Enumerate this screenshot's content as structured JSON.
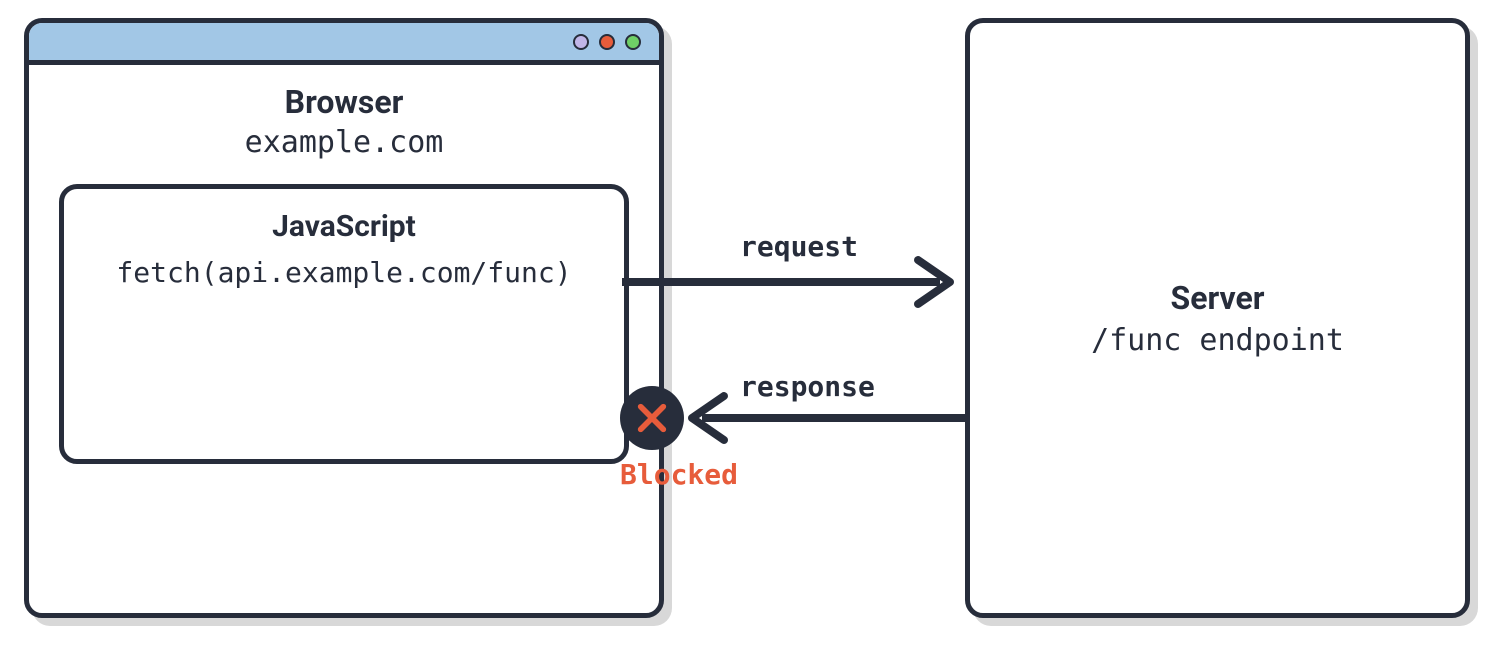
{
  "browser": {
    "heading": "Browser",
    "domain": "example.com",
    "traffic_lights": [
      "purple",
      "red",
      "green"
    ],
    "js": {
      "heading": "JavaScript",
      "code": "fetch(api.example.com/func)"
    }
  },
  "server": {
    "heading": "Server",
    "endpoint": "/func endpoint"
  },
  "arrows": {
    "request_label": "request",
    "response_label": "response"
  },
  "blocked": {
    "label": "Blocked"
  },
  "colors": {
    "dark": "#272d3b",
    "titlebar": "#a2c7e6",
    "shadow": "#d8d8d8",
    "red": "#e75c3b",
    "green": "#6fcf66",
    "purple": "#c1b6e8"
  }
}
